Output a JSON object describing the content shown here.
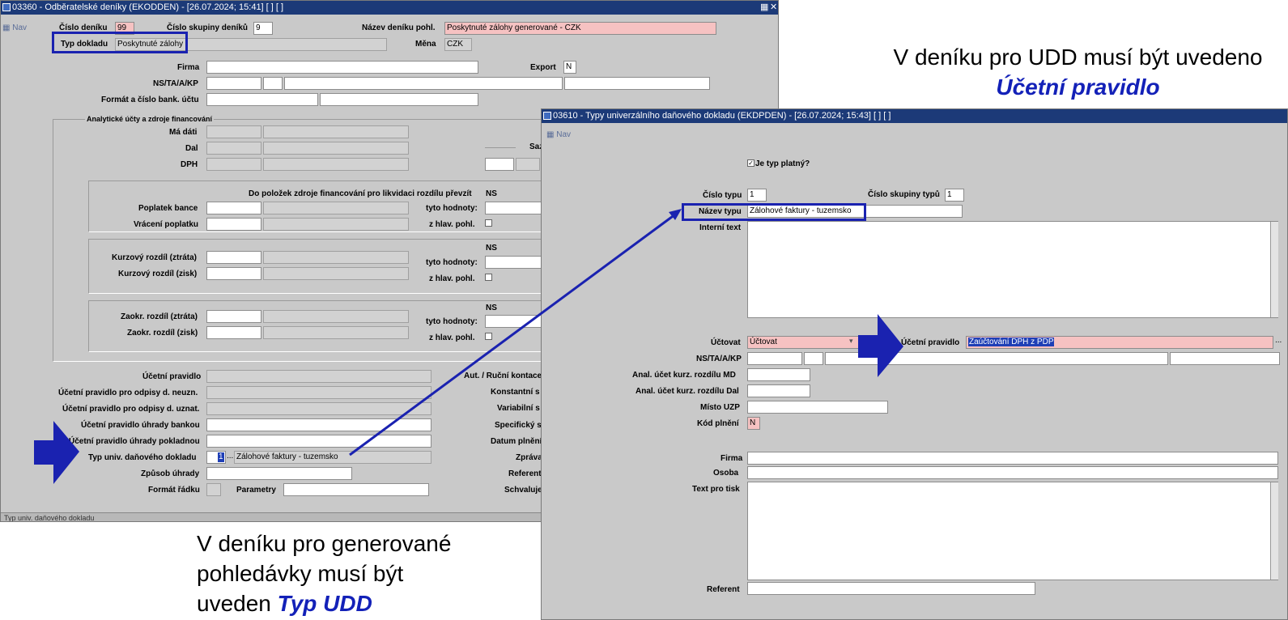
{
  "w1": {
    "title": "03360 - Odběratelské deníky (EKODDEN) - [26.07.2024; 15:41]  [ ]  [ ]",
    "nav": "Nav",
    "cislo_deniku_label": "Číslo deníku",
    "cislo_deniku": "99",
    "cislo_skupiny_label": "Číslo skupiny deníků",
    "cislo_skupiny": "9",
    "nazev_label": "Název deníku pohl.",
    "nazev": "Poskytnuté zálohy generované - CZK",
    "typ_dokladu_label": "Typ dokladu",
    "typ_dokladu": "Poskytnuté zálohy",
    "mena_label": "Měna",
    "mena": "CZK",
    "firma_label": "Firma",
    "export_label": "Export",
    "export": "N",
    "ns_label": "NS/TA/A/KP",
    "format_label": "Formát a číslo bank. účtu",
    "analyticke_label": "Analytické účty a zdroje financování",
    "ma_dati_label": "Má dáti",
    "dal_label": "Dal",
    "dph_label": "DPH",
    "saz_label": "Saz",
    "do_polozek_label": "Do položek zdroje financování pro likvidaci rozdílu převzít",
    "ns_short": "NS",
    "poplatek_label": "Poplatek bance",
    "vraceni_label": "Vrácení poplatku",
    "tyto_label": "tyto hodnoty:",
    "zhlav_label": "z hlav. pohl.",
    "kurz_ztrata_label": "Kurzový rozdíl (ztráta)",
    "kurz_zisk_label": "Kurzový rozdíl (zisk)",
    "zaokr_ztrata_label": "Zaokr. rozdíl (ztráta)",
    "zaokr_zisk_label": "Zaokr. rozdíl (zisk)",
    "ucetni_pravidlo_label": "Účetní pravidlo",
    "up_neuzn_label": "Účetní pravidlo pro odpisy d. neuzn.",
    "up_uzn_label": "Účetní pravidlo pro odpisy d. uznat.",
    "up_bankou_label": "Účetní pravidlo úhrady bankou",
    "up_pokladnou_label": "Účetní pravidlo úhrady pokladnou",
    "typ_udd_label": "Typ univ. daňového dokladu",
    "typ_udd_value": "1",
    "typ_udd_lov": "...",
    "typ_udd_name": "Zálohové faktury - tuzemsko",
    "zpusob_label": "Způsob úhrady",
    "format_radku_label": "Formát řádku",
    "parametry_label": "Parametry",
    "aut_label": "Aut. / Ruční kontace",
    "konst_label": "Konstantní s",
    "var_label": "Variabilní s",
    "spec_label": "Specifický s",
    "datum_label": "Datum plnění",
    "zprava_label": "Zpráva",
    "referent_label": "Referent",
    "schvaluje_label": "Schvaluje",
    "status_text": "Typ univ. daňového dokladu"
  },
  "w2": {
    "title": "03610 - Typy univerzálního daňového dokladu (EKDPDEN) - [26.07.2024; 15:43]  [ ]  [ ]",
    "nav": "Nav",
    "je_typ_platny_label": "Je typ platný?",
    "cislo_typu_label": "Číslo typu",
    "cislo_typu": "1",
    "cislo_skupiny_label": "Číslo skupiny typů",
    "cislo_skupiny": "1",
    "nazev_typu_label": "Název typu",
    "nazev_typu": "Zálohové faktury - tuzemsko",
    "interni_text_label": "Interní text",
    "uctovat_label": "Účtovat",
    "uctovat": "Účtovat",
    "ucetni_pravidlo_label": "Účetní pravidlo",
    "ucetni_pravidlo": "Zaúčtování DPH z PDP",
    "ns_label": "NS/TA/A/KP",
    "anal_md_label": "Anal. účet kurz. rozdílu MD",
    "anal_dal_label": "Anal. účet kurz. rozdílu Dal",
    "misto_label": "Místo UZP",
    "kod_label": "Kód plnění",
    "kod": "N",
    "firma_label": "Firma",
    "osoba_label": "Osoba",
    "text_tisk_label": "Text pro tisk",
    "referent_label": "Referent"
  },
  "annotations": {
    "top_line1": "V deníku pro UDD musí být uvedeno",
    "top_line2": "Účetní pravidlo",
    "bottom_line1": "V deníku pro generované",
    "bottom_line2": "pohledávky musí být",
    "bottom_line3_prefix": "uveden",
    "bottom_line3_emph": "Typ UDD"
  },
  "colors": {
    "title_bar": "#1c3a78",
    "form_bg": "#c9c9c9",
    "required_field": "#f6c2c2",
    "highlight": "#1a22b0",
    "emphasis_text": "#1321b8"
  },
  "icons": [
    "form-icon",
    "arrow-right-icon",
    "connector-arrow-icon"
  ]
}
